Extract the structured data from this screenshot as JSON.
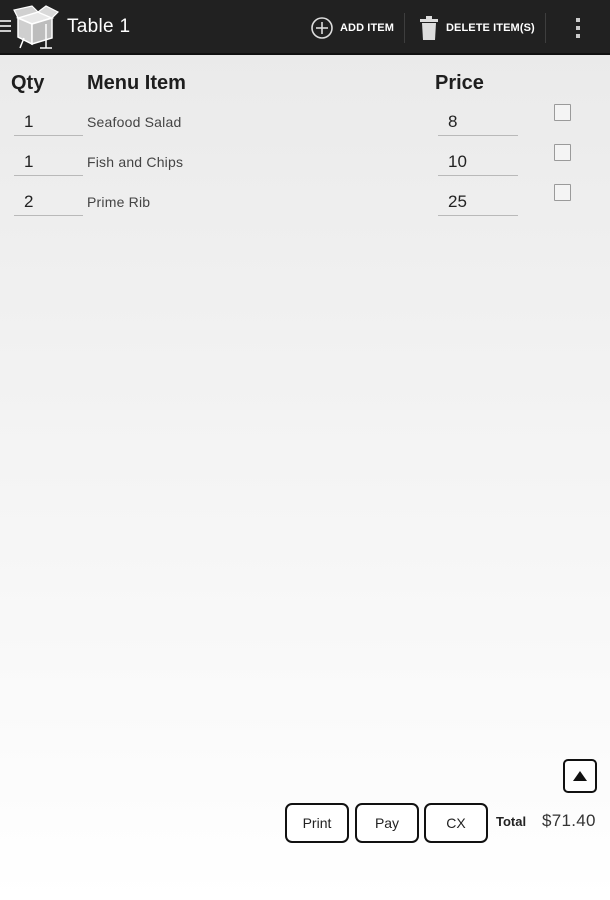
{
  "actionbar": {
    "title": "Table 1",
    "add_item_label": "ADD ITEM",
    "delete_items_label": "DELETE ITEM(S)",
    "icons": {
      "drawer": "drawer-menu-icon",
      "app": "takeout-box-icon",
      "add": "plus-circle-icon",
      "delete": "trash-icon",
      "overflow": "more-vertical-icon"
    }
  },
  "table": {
    "columns": {
      "qty": "Qty",
      "item": "Menu Item",
      "price": "Price"
    },
    "rows": [
      {
        "qty": "1",
        "item": "Seafood Salad",
        "price": "8",
        "checked": false
      },
      {
        "qty": "1",
        "item": "Fish and Chips",
        "price": "10",
        "checked": false
      },
      {
        "qty": "2",
        "item": "Prime Rib",
        "price": "25",
        "checked": false
      }
    ]
  },
  "footer": {
    "print_label": "Print",
    "pay_label": "Pay",
    "cx_label": "CX",
    "total_label": "Total",
    "total_value": "$71.40",
    "scroll_icon": "triangle-up-icon"
  }
}
